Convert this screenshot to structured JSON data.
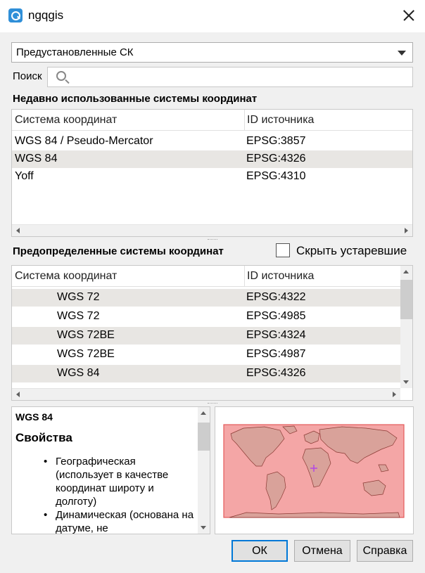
{
  "window": {
    "title": "ngqgis"
  },
  "preset_combo": {
    "value": "Предустановленные СК"
  },
  "search": {
    "label": "Поиск",
    "value": ""
  },
  "recent": {
    "title": "Недавно использованные системы координат",
    "columns": [
      "Система координат",
      "ID источника"
    ],
    "rows": [
      {
        "name": "WGS 84 / Pseudo-Mercator",
        "id": "EPSG:3857"
      },
      {
        "name": "WGS 84",
        "id": "EPSG:4326"
      },
      {
        "name": "Yoff",
        "id": "EPSG:4310"
      }
    ]
  },
  "predefined": {
    "title": "Предопределенные системы координат",
    "hide_deprecated_label": "Скрыть устаревшие",
    "hide_deprecated_checked": false,
    "columns": [
      "Система координат",
      "ID источника"
    ],
    "rows": [
      {
        "name": "WGS 72",
        "id": "EPSG:4322"
      },
      {
        "name": "WGS 72",
        "id": "EPSG:4985"
      },
      {
        "name": "WGS 72BE",
        "id": "EPSG:4324"
      },
      {
        "name": "WGS 72BE",
        "id": "EPSG:4987"
      },
      {
        "name": "WGS 84",
        "id": "EPSG:4326"
      }
    ]
  },
  "info": {
    "name": "WGS 84",
    "heading": "Свойства",
    "properties": [
      "Географическая (использует в качестве координат широту и долготу)",
      "Динамическая (основана на датуме, не"
    ]
  },
  "map": {
    "extent_fill": "#f4a6a6",
    "land_color": "#d9a29a",
    "marker_color": "#b44de0"
  },
  "buttons": {
    "ok": "ОК",
    "cancel": "Отмена",
    "help": "Справка"
  }
}
